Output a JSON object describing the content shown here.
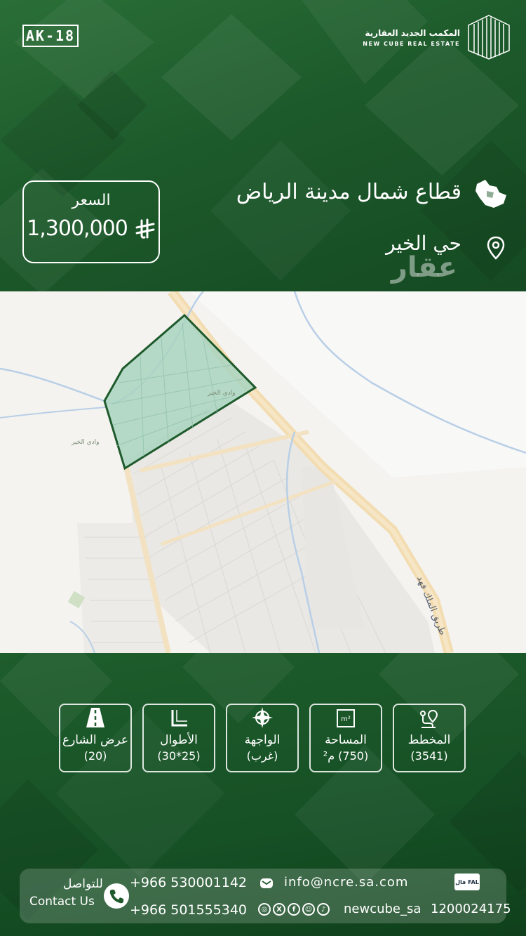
{
  "header": {
    "listing_code": "AK-18",
    "brand_name_ar": "المكمب الجديد العقارية",
    "brand_name_en": "NEW CUBE REAL ESTATE"
  },
  "price": {
    "label": "السعر",
    "value": "1,300,000",
    "currency_icon": "saudi-riyal-icon"
  },
  "location": {
    "sector": "قطاع شمال مدينة الرياض",
    "sector_icon": "saudi-map-icon",
    "district": "حي الخير",
    "district_icon": "location-pin-icon",
    "watermark": "عقار"
  },
  "map": {
    "road_label": "طريق الملك فهد",
    "area_label_1": "وادي الخير",
    "area_label_2": "وادي الخير"
  },
  "specs": [
    {
      "label": "المخطط",
      "value": "(3541)",
      "icon": "plan-pin-icon"
    },
    {
      "label": "المساحة",
      "value": "(750)  م²",
      "icon": "area-m2-icon"
    },
    {
      "label": "الواجهة",
      "value": "(غرب)",
      "icon": "compass-icon"
    },
    {
      "label": "الأطوال",
      "value": "(25*30)",
      "icon": "dimensions-icon"
    },
    {
      "label": "عرض الشارع",
      "value": "(20)",
      "icon": "road-icon"
    }
  ],
  "contact": {
    "label_ar": "للتواصل",
    "label_en": "Contact Us",
    "phone_1": "+966 530001142",
    "phone_2": "+966 501555340",
    "email": "info@ncre.sa.com",
    "social_handle": "newcube_sa",
    "fal_badge": "فال FAL",
    "license_number": "1200024175"
  },
  "colors": {
    "primary_green": "#1f5a2c",
    "map_parcel_fill": "#a9d3c0",
    "map_parcel_stroke": "#1e5a2c",
    "road_color": "#f2dcb0"
  }
}
